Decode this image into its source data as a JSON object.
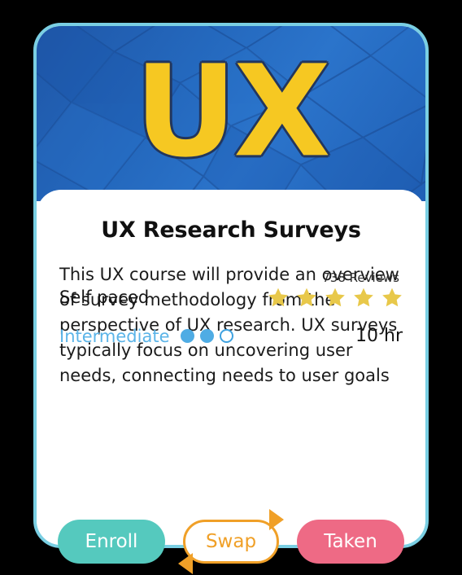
{
  "card": {
    "hero": {
      "label": "UX",
      "icon": "course-banner-image",
      "background_color": "#2468bd",
      "label_color": "#F6C822"
    },
    "border_color": "#7ACFE3",
    "title": "UX Research Surveys",
    "description": "This UX course will provide an overview of survey methodology from the perspective of UX research. UX surveys typically focus on uncovering user needs, connecting needs to user goals and behaviors, and measuring user sentiment.",
    "reviews_count": "738 Reviews",
    "pace": "Self paced",
    "rating": {
      "value": 5,
      "max": 5,
      "star_color": "#E8C84A"
    },
    "level": {
      "label": "Intermediate",
      "color": "#5BB4E8",
      "filled_dots": 2,
      "total_dots": 3
    },
    "duration": "10 hr"
  },
  "actions": {
    "enroll": {
      "label": "Enroll",
      "color": "#55C9BE"
    },
    "swap": {
      "label": "Swap",
      "color": "#F0A028",
      "icon": "swap-arrows-icon"
    },
    "taken": {
      "label": "Taken",
      "color": "#EE6A85"
    }
  }
}
